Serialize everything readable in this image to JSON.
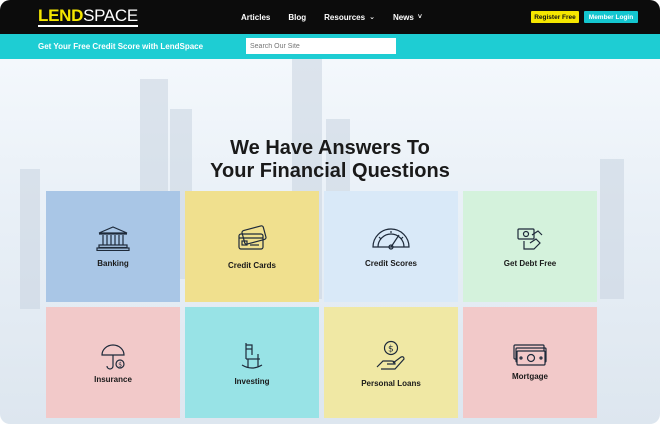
{
  "nav": {
    "logo_lend": "LEND",
    "logo_space": "SPACE",
    "links": [
      {
        "label": "Articles"
      },
      {
        "label": "Blog"
      },
      {
        "label": "Resources",
        "caret": "⌄"
      },
      {
        "label": "News",
        "caret": "˅"
      }
    ],
    "register_label": "Register Free",
    "login_label": "Member Login"
  },
  "subbar": {
    "credit_link": "Get Your Free Credit Score with LendSpace",
    "search_placeholder": "Search Our Site"
  },
  "headline": {
    "line1": "We Have Answers To",
    "line2": "Your Financial Questions"
  },
  "tiles": [
    {
      "label": "Banking",
      "icon": "bank-icon",
      "color": "#a9c6e6"
    },
    {
      "label": "Credit Cards",
      "icon": "credit-card-icon",
      "color": "#f0e08e"
    },
    {
      "label": "Credit Scores",
      "icon": "gauge-icon",
      "color": "#d9e9f8"
    },
    {
      "label": "Get Debt Free",
      "icon": "debt-free-icon",
      "color": "#d4f2dc"
    },
    {
      "label": "Insurance",
      "icon": "umbrella-icon",
      "color": "#f2c9c9"
    },
    {
      "label": "Investing",
      "icon": "rocking-chair-icon",
      "color": "#98e3e6"
    },
    {
      "label": "Personal Loans",
      "icon": "hand-coin-icon",
      "color": "#f0e8a4"
    },
    {
      "label": "Mortgage",
      "icon": "money-stack-icon",
      "color": "#f2c9c9"
    }
  ]
}
